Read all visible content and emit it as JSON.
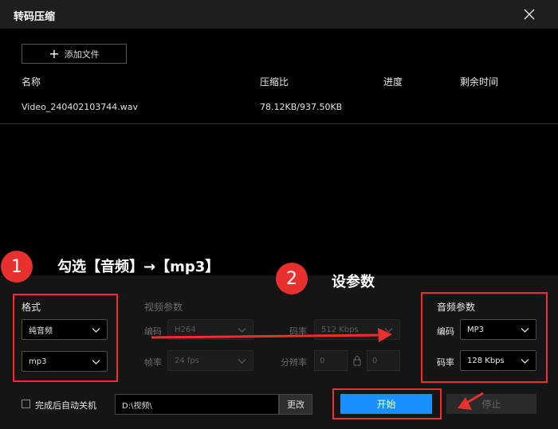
{
  "window": {
    "title": "转码压缩"
  },
  "file_list": {
    "add_button_label": "添加文件",
    "columns": [
      "名称",
      "压缩比",
      "进度",
      "剩余时间"
    ],
    "rows": [
      {
        "name": "Video_240402103744.wav",
        "ratio": "78.12KB/937.50KB",
        "progress": "",
        "remaining": ""
      }
    ]
  },
  "annotations": {
    "step1_number": "1",
    "step1_text": "勾选【音频】→【mp3】",
    "step2_number": "2",
    "step2_text": "设参数"
  },
  "format": {
    "title": "格式",
    "type_value": "纯音频",
    "container_value": "mp3"
  },
  "video_params": {
    "title": "视频参数",
    "codec_label": "编码",
    "codec_value": "H264",
    "fps_label": "帧率",
    "fps_value": "24 fps",
    "bitrate_label": "码率",
    "bitrate_value": "512 Kbps",
    "resolution_label": "分辨率",
    "width_value": "0",
    "height_value": "0"
  },
  "audio_params": {
    "title": "音频参数",
    "codec_label": "编码",
    "codec_value": "MP3",
    "bitrate_label": "码率",
    "bitrate_value": "128 Kbps"
  },
  "footer": {
    "shutdown_label": "完成后自动关机",
    "output_path": "D:\\视频\\",
    "change_label": "更改",
    "start_label": "开始",
    "stop_label": "停止"
  },
  "colors": {
    "accent": "#1890ff",
    "annotation_red": "#e8312f",
    "background": "#000000",
    "panel": "#151515"
  }
}
